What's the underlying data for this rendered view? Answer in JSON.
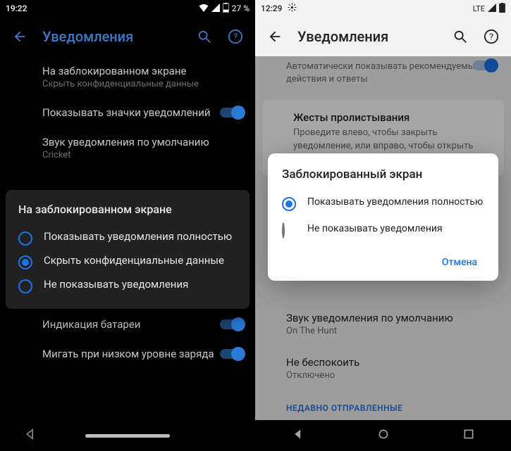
{
  "left": {
    "status": {
      "time": "19:22",
      "battery_pct": "27 %"
    },
    "appbar": {
      "title": "Уведомления"
    },
    "rows": {
      "lock": {
        "primary": "На заблокированном экране",
        "secondary": "Скрыть конфиденциальные данные"
      },
      "badges": {
        "primary": "Показывать значки уведомлений"
      },
      "sound": {
        "primary": "Звук уведомления по умолчанию",
        "secondary": "Cricket"
      },
      "battled": {
        "primary": "Индикация батареи"
      },
      "blink": {
        "primary": "Мигать при низком уровне заряда"
      }
    },
    "dialog": {
      "title": "На заблокированном экране",
      "opt1": "Показывать уведомления полностью",
      "opt2": "Скрыть конфиденциальные данные",
      "opt3": "Не показывать уведомления"
    }
  },
  "right": {
    "status": {
      "time": "12:29",
      "net": "LTE"
    },
    "appbar": {
      "title": "Уведомления"
    },
    "autoreply": {
      "secondary": "Автоматически показывать рекомендуемые действия и ответы"
    },
    "swipe": {
      "primary": "Жесты пролистывания",
      "secondary": "Проведите влево, чтобы закрыть уведомление, или вправо, чтобы открыть меню"
    },
    "sound": {
      "primary": "Звук уведомления по умолчанию",
      "secondary": "On The Hunt"
    },
    "dnd": {
      "primary": "Не беспокоить",
      "secondary": "Отключено"
    },
    "recent": "НЕДАВНО ОТПРАВЛЕННЫЕ",
    "dialog": {
      "title": "Заблокированный экран",
      "opt1": "Показывать уведомления полностью",
      "opt2": "Не показывать уведомления",
      "cancel": "Отмена"
    }
  }
}
